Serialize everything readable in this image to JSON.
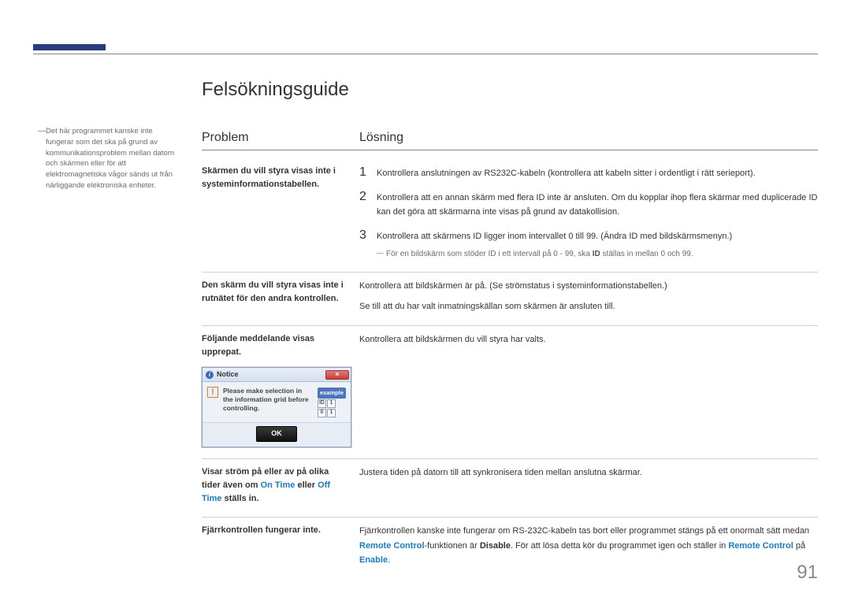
{
  "page_number": "91",
  "title": "Felsökningsguide",
  "sidenote": "Det här programmet kanske inte fungerar som det ska på grund av kommunikationsproblem mellan datorn och skärmen eller för att elektromagnetiska vågor sänds ut från närliggande elektroniska enheter.",
  "headers": {
    "problem": "Problem",
    "solution": "Lösning"
  },
  "rows": {
    "r1": {
      "problem": "Skärmen du vill styra visas inte i systeminformationstabellen.",
      "n1": "1",
      "s1": "Kontrollera anslutningen av RS232C-kabeln (kontrollera att kabeln sitter i ordentligt i rätt serieport).",
      "n2": "2",
      "s2": "Kontrollera att en annan skärm med flera ID inte är ansluten. Om du kopplar ihop flera skärmar med duplicerade ID kan det göra att skärmarna inte visas på grund av datakollision.",
      "n3": "3",
      "s3": "Kontrollera att skärmens ID ligger inom intervallet 0 till 99. (Ändra ID med bildskärmsmenyn.)",
      "footnote_pre": "För en bildskärm som stöder ID i ett intervall på 0 - 99, ska ",
      "footnote_bold": "ID",
      "footnote_post": " ställas in mellan 0 och 99."
    },
    "r2": {
      "problem": "Den skärm du vill styra visas inte i rutnätet för den andra kontrollen.",
      "s1": "Kontrollera att bildskärmen är på. (Se strömstatus i systeminformationstabellen.)",
      "s2": "Se till att du har valt inmatningskällan som skärmen är ansluten till."
    },
    "r3": {
      "problem": "Följande meddelande visas upprepat.",
      "solution": "Kontrollera att bildskärmen du vill styra har valts.",
      "dialog": {
        "title": "Notice",
        "message": "Please make selection in the information grid before controlling.",
        "example": "example",
        "ok": "OK",
        "close": "×",
        "c1": "ID",
        "c2": "1",
        "c3": "0",
        "c4": "1"
      }
    },
    "r4": {
      "problem_pre": "Visar ström på eller av på olika tider även om ",
      "on_time": "On Time",
      "eller": " eller ",
      "off_time": "Off Time",
      "problem_post": " ställs in.",
      "solution": "Justera tiden på datorn till att synkronisera tiden mellan anslutna skärmar."
    },
    "r5": {
      "problem": "Fjärrkontrollen fungerar inte.",
      "pre1": "Fjärrkontrollen kanske inte fungerar om RS-232C-kabeln tas bort eller programmet stängs på ett onormalt sätt medan ",
      "rc1": "Remote Control",
      "mid1": "-funktionen är ",
      "dis": "Disable",
      "mid2": ". För att lösa detta kör du programmet igen och ställer in ",
      "rc2": "Remote Control",
      "mid3": " på ",
      "en": "Enable",
      "end": "."
    }
  }
}
